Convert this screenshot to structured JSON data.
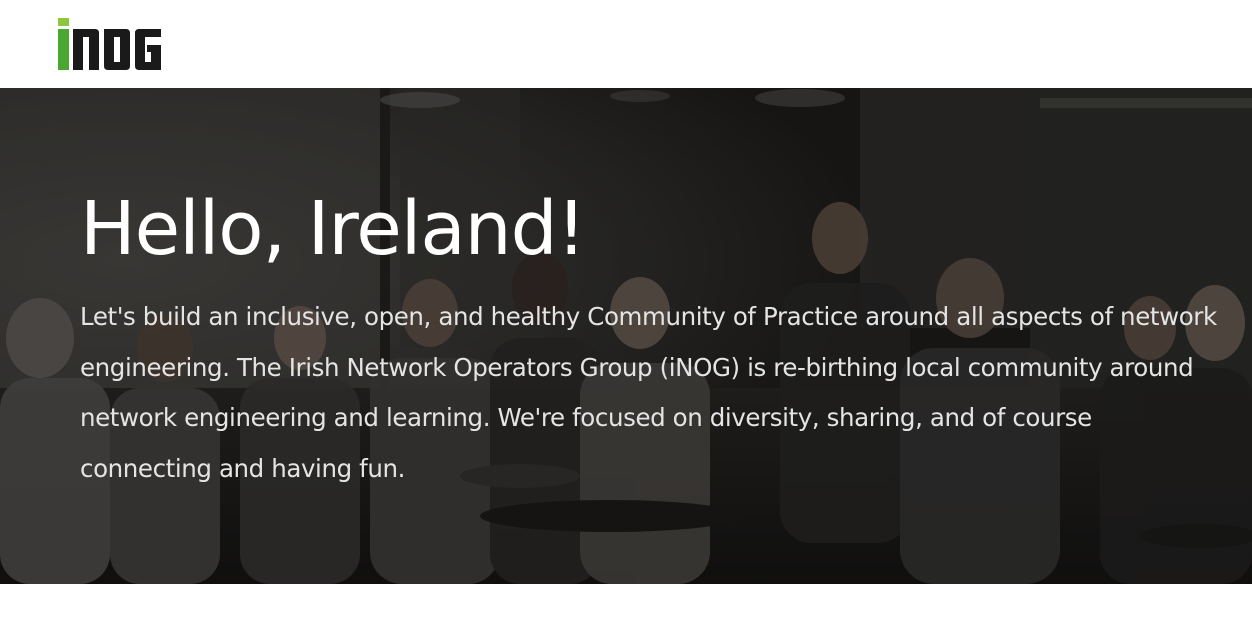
{
  "header": {
    "logo_text": "iNOG",
    "colors": {
      "logo_dot": "#8dc63f",
      "logo_i_stem": "#4aa832",
      "logo_letters": "#1a1a1a"
    }
  },
  "hero": {
    "title": "Hello, Ireland!",
    "text": "Let's build an inclusive, open, and healthy Community of Practice around all aspects of network engineering. The Irish Network Operators Group (iNOG) is re-birthing local community around network engineering and learning. We're focused on diversity, sharing, and of course connecting and having fun.",
    "background_description_icon": "meetup-photo"
  }
}
